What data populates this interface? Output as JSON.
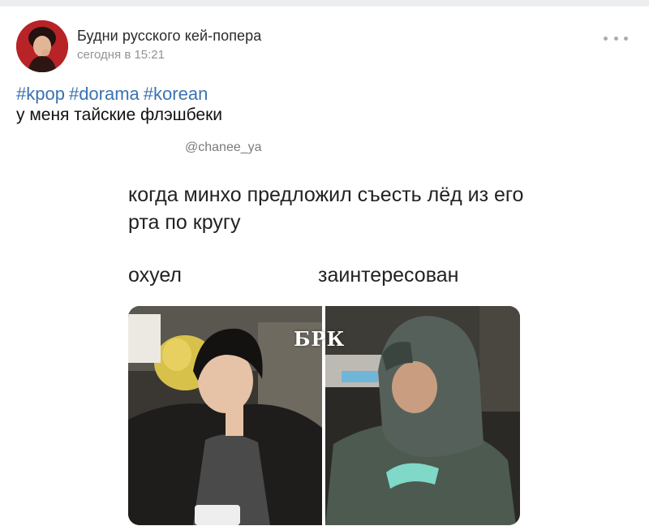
{
  "post": {
    "author": "Будни русского кей-попера",
    "time": "сегодня в 15:21",
    "hashtags": [
      "#kpop",
      "#dorama",
      "#korean"
    ],
    "text": "у меня тайские флэшбеки"
  },
  "meme": {
    "handle": "@chanee_ya",
    "caption": "когда минхо предложил съесть лёд из его рта по кругу",
    "label_left": "охуел",
    "label_right": "заинтересован",
    "watermark": "БРК"
  },
  "colors": {
    "hashtag": "#3b73b0",
    "avatar_bg": "#b32127"
  },
  "icons": {
    "more": "more-horizontal-icon"
  }
}
